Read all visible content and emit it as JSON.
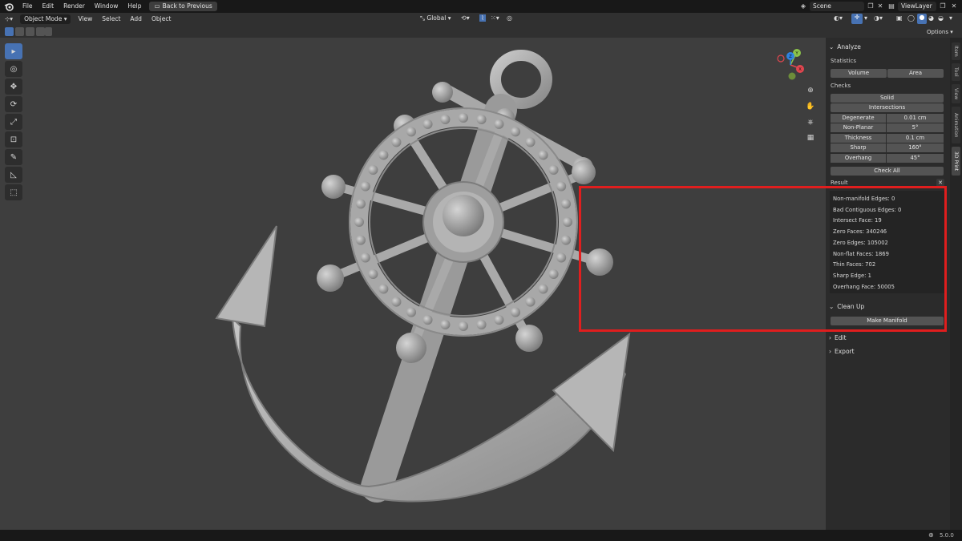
{
  "topbar": {
    "menu": [
      "File",
      "Edit",
      "Render",
      "Window",
      "Help"
    ],
    "back_button": "Back to Previous",
    "scene": "Scene",
    "view_layer": "ViewLayer"
  },
  "header": {
    "mode": "Object Mode",
    "menu": [
      "View",
      "Select",
      "Add",
      "Object"
    ],
    "orientation": "Global",
    "options": "Options"
  },
  "sidebar": {
    "analyze": {
      "title": "Analyze",
      "statistics_label": "Statistics",
      "volume": "Volume",
      "area": "Area",
      "checks_label": "Checks",
      "solid": "Solid",
      "intersections": "Intersections",
      "rows": [
        {
          "key": "Degenerate",
          "value": "0.01 cm"
        },
        {
          "key": "Non-Planar",
          "value": "5°"
        },
        {
          "key": "Thickness",
          "value": "0.1 cm"
        },
        {
          "key": "Sharp",
          "value": "160°"
        },
        {
          "key": "Overhang",
          "value": "45°"
        }
      ],
      "check_all": "Check All",
      "result_label": "Result",
      "results": [
        "Non-manifold Edges: 0",
        "Bad Contiguous Edges: 0",
        "Intersect Face: 19",
        "Zero Faces: 340246",
        "Zero Edges: 105002",
        "Non-flat Faces: 1869",
        "Thin Faces: 702",
        "Sharp Edge: 1",
        "Overhang Face: 50005"
      ]
    },
    "cleanup": {
      "title": "Clean Up",
      "make_manifold": "Make Manifold"
    },
    "edit": {
      "title": "Edit"
    },
    "export": {
      "title": "Export"
    }
  },
  "tabs": [
    "Item",
    "Tool",
    "View",
    "Animation",
    "3D Print"
  ],
  "gizmo": {
    "x": "X",
    "y": "Y",
    "z": "Z"
  },
  "status": {
    "version": "5.0.0"
  },
  "colors": {
    "accent": "#4772b3",
    "highlight_box": "#e01e1e",
    "x_axis": "#e0464f",
    "y_axis": "#8bc34a",
    "z_axis": "#2f82e0"
  }
}
